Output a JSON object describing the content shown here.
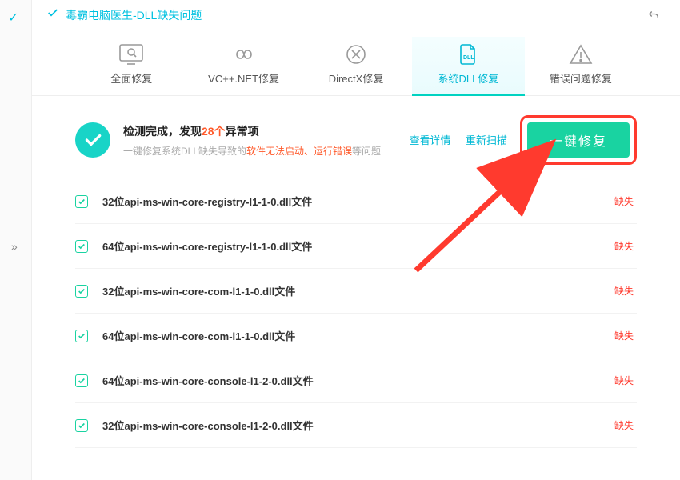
{
  "titlebar": {
    "title": "毒霸电脑医生-DLL缺失问题"
  },
  "tabs": [
    {
      "id": "full",
      "label": "全面修复"
    },
    {
      "id": "vcnet",
      "label": "VC++.NET修复"
    },
    {
      "id": "directx",
      "label": "DirectX修复"
    },
    {
      "id": "dll",
      "label": "系统DLL修复",
      "active": true
    },
    {
      "id": "error",
      "label": "错误问题修复"
    }
  ],
  "summary": {
    "title_pre": "检测完成，发现",
    "count": "28个",
    "title_post": "异常项",
    "sub_pre": "一键修复系统DLL缺失导致的",
    "sub_em1": "软件无法启动、",
    "sub_em2": "运行错误",
    "sub_post": "等问题",
    "link_detail": "查看详情",
    "link_rescan": "重新扫描",
    "fix_button": "一键修复"
  },
  "status_label": "缺失",
  "items": [
    {
      "name": "32位api-ms-win-core-registry-l1-1-0.dll文件"
    },
    {
      "name": "64位api-ms-win-core-registry-l1-1-0.dll文件"
    },
    {
      "name": "32位api-ms-win-core-com-l1-1-0.dll文件"
    },
    {
      "name": "64位api-ms-win-core-com-l1-1-0.dll文件"
    },
    {
      "name": "64位api-ms-win-core-console-l1-2-0.dll文件"
    },
    {
      "name": "32位api-ms-win-core-console-l1-2-0.dll文件"
    }
  ]
}
